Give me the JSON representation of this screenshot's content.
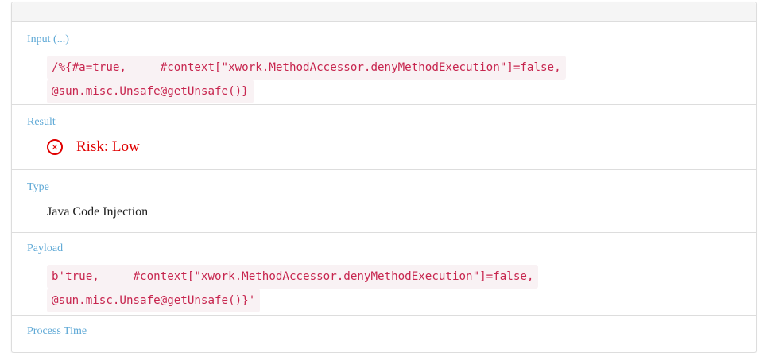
{
  "sections": {
    "input": {
      "label": "Input (...)",
      "line1": "/%{#a=true,     #context[\"xwork.MethodAccessor.denyMethodExecution\"]=false,",
      "line2": "@sun.misc.Unsafe@getUnsafe()}"
    },
    "result": {
      "label": "Result",
      "icon": "error-circle-icon",
      "value": "Risk: Low",
      "color": "#e00000"
    },
    "type": {
      "label": "Type",
      "value": "Java Code Injection"
    },
    "payload": {
      "label": "Payload",
      "line1": "b'true,     #context[\"xwork.MethodAccessor.denyMethodExecution\"]=false,",
      "line2": "@sun.misc.Unsafe@getUnsafe()}'"
    },
    "process_time": {
      "label": "Process Time"
    }
  },
  "colors": {
    "label": "#5fa9d6",
    "code_text": "#c7254e",
    "code_bg": "#f9f2f4"
  }
}
